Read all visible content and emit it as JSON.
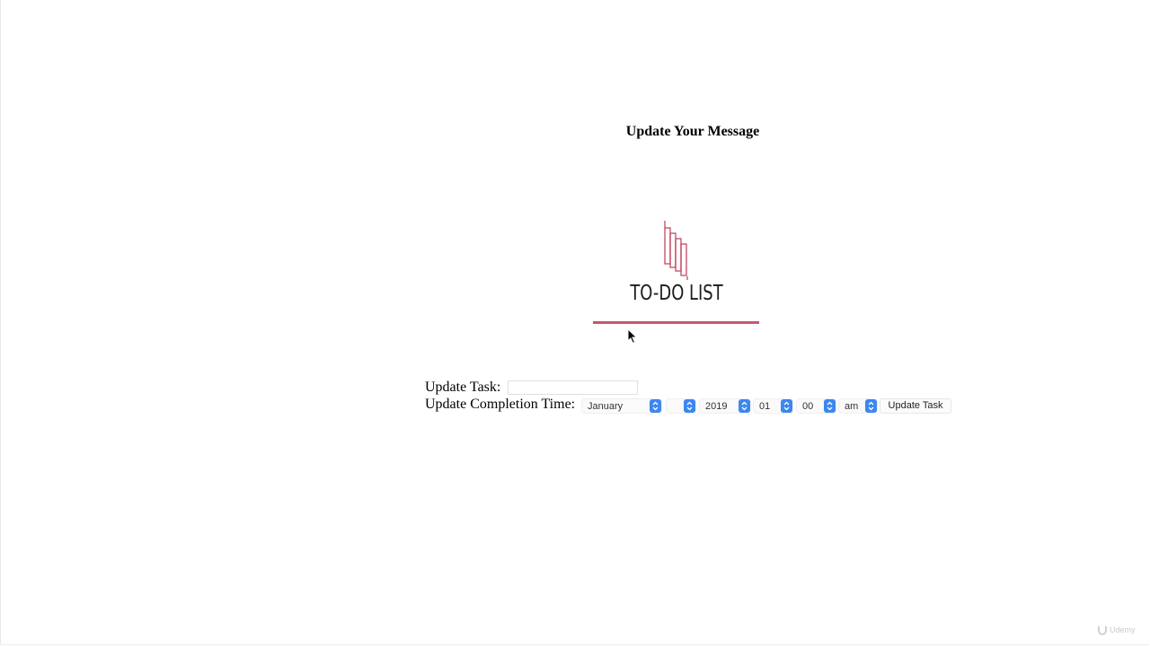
{
  "page": {
    "heading": "Update Your Message"
  },
  "logo": {
    "text": "TO-DO LIST",
    "icon": "notepad-icon",
    "accent_color": "#c8566c"
  },
  "form": {
    "task_label": "Update Task:",
    "task_value": "",
    "time_label": "Update Completion Time:",
    "month": "January",
    "day": "",
    "year": "2019",
    "hour": "01",
    "minute": "00",
    "ampm": "am",
    "submit_label": "Update Task"
  },
  "watermark": {
    "text": "Udemy"
  },
  "colors": {
    "select_arrow": "#3c87f0"
  }
}
